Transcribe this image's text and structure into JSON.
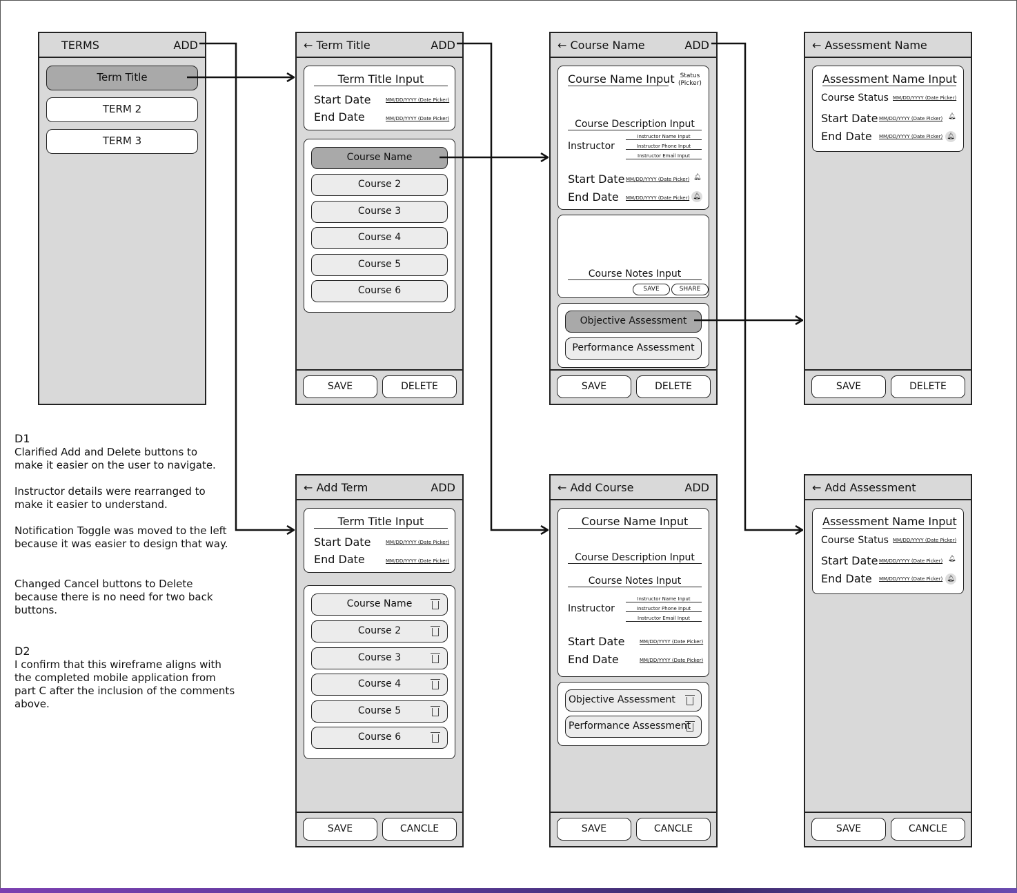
{
  "back_arrow": "←",
  "screens": {
    "terms": {
      "title": "TERMS",
      "add": "ADD",
      "items": [
        "Term Title",
        "TERM 2",
        "TERM 3"
      ]
    },
    "term_detail": {
      "title": "Term Title",
      "add": "ADD",
      "title_input": "Term Title Input",
      "start_label": "Start Date",
      "end_label": "End Date",
      "date_picker": "MM/DD/YYYY (Date Picker)",
      "courses": [
        "Course Name",
        "Course 2",
        "Course 3",
        "Course 4",
        "Course 5",
        "Course 6"
      ],
      "save": "SAVE",
      "delete": "DELETE"
    },
    "course_detail": {
      "title": "Course Name",
      "add": "ADD",
      "name_input": "Course Name Input",
      "status_line1": "Status",
      "status_line2": "(Picker)",
      "description_input": "Course Description Input",
      "instructor_label": "Instructor",
      "instructor_name": "Instructor Name Input",
      "instructor_phone": "Instructor Phone Input",
      "instructor_email": "Instructor Email Input",
      "start_label": "Start Date",
      "end_label": "End Date",
      "date_picker": "MM/DD/YYYY (Date Picker)",
      "notes_input": "Course Notes Input",
      "notes_save": "SAVE",
      "notes_share": "SHARE",
      "assessments": [
        "Objective Assessment",
        "Performance Assessment"
      ],
      "save": "SAVE",
      "delete": "DELETE"
    },
    "assessment_detail": {
      "title": "Assessment Name",
      "name_input": "Assessment Name Input",
      "status_label": "Course Status",
      "start_label": "Start Date",
      "end_label": "End Date",
      "date_picker": "MM/DD/YYYY (Date Picker)",
      "save": "SAVE",
      "delete": "DELETE"
    },
    "add_term": {
      "title": "Add Term",
      "add": "ADD",
      "title_input": "Term Title Input",
      "start_label": "Start Date",
      "end_label": "End Date",
      "date_picker": "MM/DD/YYYY (Date Picker)",
      "courses": [
        "Course Name",
        "Course 2",
        "Course 3",
        "Course 4",
        "Course 5",
        "Course 6"
      ],
      "save": "SAVE",
      "cancel": "CANCLE"
    },
    "add_course": {
      "title": "Add Course",
      "add": "ADD",
      "name_input": "Course Name Input",
      "description_input": "Course Description Input",
      "notes_input": "Course Notes Input",
      "instructor_label": "Instructor",
      "instructor_name": "Instructor Name Input",
      "instructor_phone": "Instructor Phone Input",
      "instructor_email": "Instructor Email Input",
      "start_label": "Start Date",
      "end_label": "End Date",
      "date_picker": "MM/DD/YYYY (Date Picker)",
      "assessments": [
        "Objective Assessment",
        "Performance Assessment"
      ],
      "save": "SAVE",
      "cancel": "CANCLE"
    },
    "add_assessment": {
      "title": "Add Assessment",
      "name_input": "Assessment Name Input",
      "status_label": "Course Status",
      "start_label": "Start Date",
      "end_label": "End Date",
      "date_picker": "MM/DD/YYYY (Date Picker)",
      "save": "SAVE",
      "cancel": "CANCLE"
    }
  },
  "notes": {
    "d1_heading": "D1",
    "d1_p1": "Clarified Add and Delete buttons to make it easier on the user to navigate.",
    "d1_p2": "Instructor details were rearranged to make it easier to understand.",
    "d1_p3": "Notification Toggle was moved to the left because it was easier to design that way.",
    "d1_p4": "Changed Cancel buttons to Delete because there is no need for two back buttons.",
    "d2_heading": "D2",
    "d2_p1": "I confirm that this wireframe aligns with the completed mobile application from part C after the inclusion of the comments above."
  },
  "colors": {
    "screen_bg": "#d9d9d9",
    "selected": "#a9a9a9",
    "pill_light": "#ececec"
  }
}
